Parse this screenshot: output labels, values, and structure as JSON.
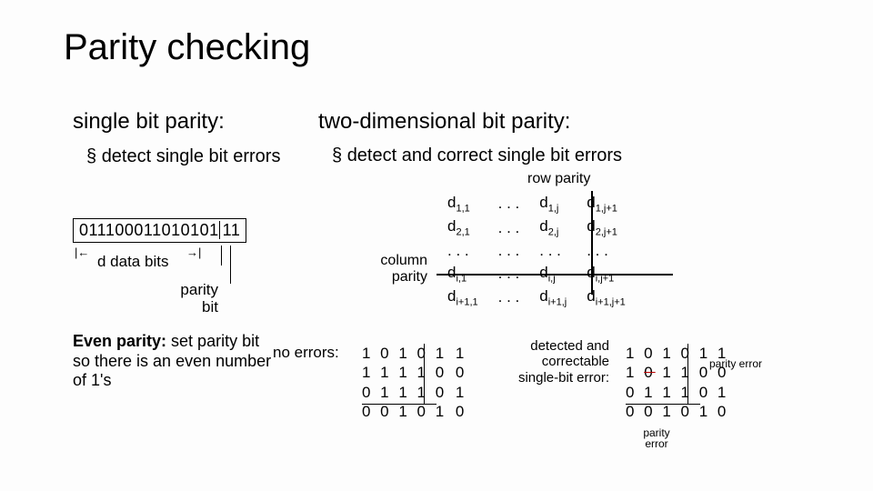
{
  "title": "Parity checking",
  "left": {
    "heading": "single bit parity:",
    "bullet": "detect single bit errors",
    "bits": "011100011010101",
    "lastbit": "11",
    "data_bits_label": "d data bits",
    "parity_bit_label": "parity bit",
    "even_parity_bold": "Even parity:",
    "even_parity_rest": " set parity bit so there is an even number of 1's"
  },
  "right": {
    "heading": "two-dimensional bit parity:",
    "bullet": "detect and correct single bit errors",
    "row_parity": "row parity",
    "column_parity": "column parity",
    "matrix": {
      "r1c1": "d",
      "r1c1s": "1,1",
      "r1c2": ". . .",
      "r1c3": "d",
      "r1c3s": "1,j",
      "r1c4": "d",
      "r1c4s": "1,j+1",
      "r2c1": "d",
      "r2c1s": "2,1",
      "r2c2": ". . .",
      "r2c3": "d",
      "r2c3s": "2,j",
      "r2c4": "d",
      "r2c4s": "2,j+1",
      "r3c1": ". . .",
      "r3c2": ". . .",
      "r3c3": ". . .",
      "r3c4": ". . .",
      "r4c1": "d",
      "r4c1s": "i,1",
      "r4c2": ". . .",
      "r4c3": "d",
      "r4c3s": "i,j",
      "r4c4": "d",
      "r4c4s": "i,j+1",
      "r5c1": "d",
      "r5c1s": "i+1,1",
      "r5c2": ". . .",
      "r5c3": "d",
      "r5c3s": "i+1,j",
      "r5c4": "d",
      "r5c4s": "i+1,j+1"
    },
    "noerrors_label": "no errors:",
    "grid1": {
      "r1": "1 0 1 0 1",
      "p1": "1",
      "r2": "1 1 1 1 0",
      "p2": "0",
      "r3": "0 1 1 1 0",
      "p3": "1",
      "r4": "0 0 1 0 1",
      "p4": "0"
    },
    "detected_label": "detected and correctable single-bit error:",
    "grid2": {
      "r1": "1 0 1 0 1",
      "p1": "1",
      "r2a": "1 ",
      "r2strike": "0",
      "r2b": " 1 1 0",
      "p2": "0",
      "r3": "0 1 1 1 0",
      "p3": "1",
      "r4": "0 0 1 0 1",
      "p4": "0"
    },
    "parity_error": "parity error"
  }
}
